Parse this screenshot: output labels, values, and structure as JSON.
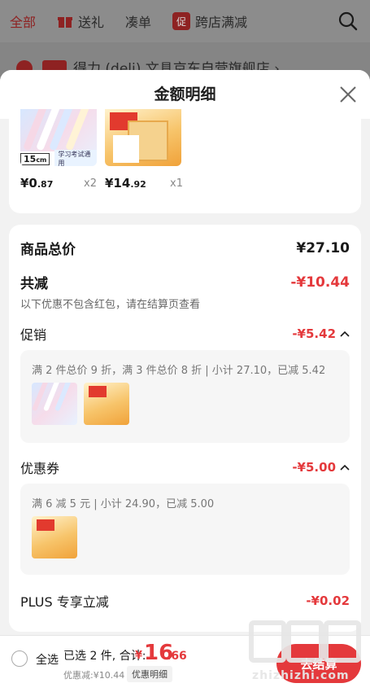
{
  "top_tabs": [
    {
      "label": "全部",
      "active": true,
      "icon": null
    },
    {
      "label": "送礼",
      "active": false,
      "icon": "gift-icon"
    },
    {
      "label": "凑单",
      "active": false,
      "icon": null
    },
    {
      "label": "跨店满减",
      "active": false,
      "icon": "promo-badge-icon",
      "icon_text": "促"
    }
  ],
  "store": {
    "name": "得力 (deli) 文具京东自营旗舰店 ›"
  },
  "sheet": {
    "title": "金额明细"
  },
  "products": [
    {
      "price_int": "¥0",
      "price_dec": ".87",
      "qty": "x2",
      "image": "pens-image",
      "ruler_label": "15",
      "ruler_unit": "cm",
      "tag": "学习考试通用"
    },
    {
      "price_int": "¥14",
      "price_dec": ".92",
      "qty": "x1",
      "image": "gift-box-image"
    }
  ],
  "summary": {
    "total_label": "商品总价",
    "total_value": "¥27.10",
    "reduce_label": "共减",
    "reduce_value": "-¥10.44",
    "reduce_note": "以下优惠不包含红包，请在结算页查看",
    "promo_label": "促销",
    "promo_value": "-¥5.42",
    "promo_detail": "满 2 件总价 9 折，满 3 件总价 8 折 | 小计 27.10，已减 5.42",
    "coupon_label": "优惠券",
    "coupon_value": "-¥5.00",
    "coupon_detail": "满 6 减 5 元 | 小计 24.90，已减 5.00",
    "plus_label": "PLUS 专享立减",
    "plus_value": "-¥0.02"
  },
  "bottom_bar": {
    "select_all": "全选",
    "selected_summary": "已选 2 件, 合计:",
    "total_symbol": "¥",
    "total_int": "16",
    "total_dec": ".66",
    "discount_line": "优惠减:¥10.44",
    "detail_link": "优惠明细",
    "checkout": "去结算"
  },
  "watermark": {
    "text": "zhizhizhi.com"
  },
  "colors": {
    "accent": "#e4393c",
    "dim": "#7d7d7d",
    "sheet_bg": "#f2f2f2"
  }
}
